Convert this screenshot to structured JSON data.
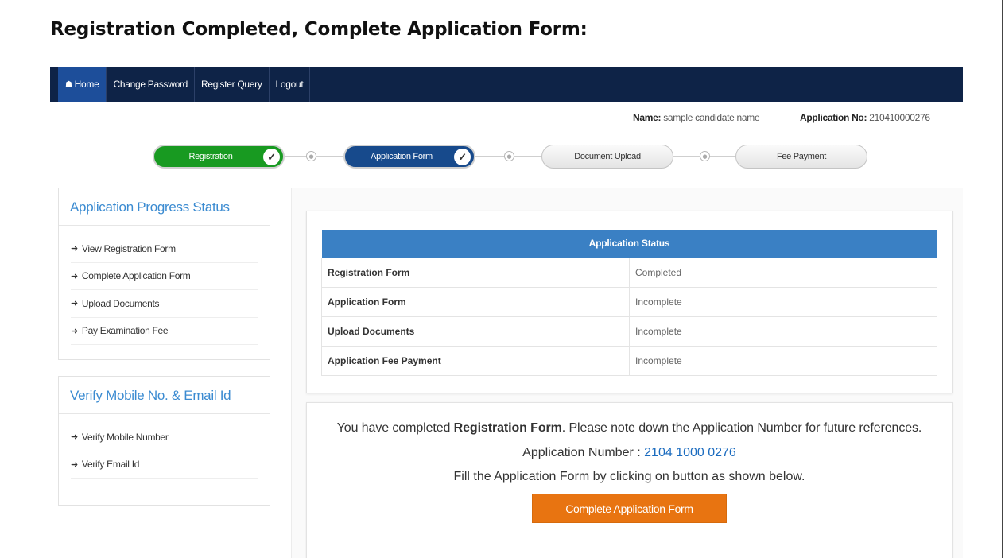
{
  "page": {
    "title": "Registration Completed, Complete Application Form:"
  },
  "nav": {
    "home": "Home",
    "change_password": "Change Password",
    "register_query": "Register Query",
    "logout": "Logout"
  },
  "candidate": {
    "name_label": "Name:",
    "name_value": "sample candidate name",
    "appno_label": "Application No:",
    "appno_value": "210410000276"
  },
  "steps": {
    "registration": "Registration",
    "application_form": "Application Form",
    "document_upload": "Document Upload",
    "fee_payment": "Fee Payment"
  },
  "progress_panel": {
    "heading": "Application Progress Status",
    "links": [
      "View Registration Form",
      "Complete Application Form",
      "Upload Documents",
      "Pay Examination Fee"
    ]
  },
  "verify_panel": {
    "heading": "Verify Mobile No. & Email Id",
    "links": [
      "Verify Mobile Number",
      "Verify Email Id"
    ]
  },
  "status_table": {
    "header": "Application Status",
    "rows": [
      {
        "label": "Registration Form",
        "status": "Completed"
      },
      {
        "label": "Application Form",
        "status": "Incomplete"
      },
      {
        "label": "Upload Documents",
        "status": "Incomplete"
      },
      {
        "label": "Application Fee Payment",
        "status": "Incomplete"
      }
    ]
  },
  "message": {
    "pre": "You have completed ",
    "bold": "Registration Form",
    "post": ". Please note down the Application Number for future references.",
    "appno_label": "Application Number : ",
    "appno_value": "2104 1000 0276",
    "fill_instruction": "Fill the Application Form by clicking on button as shown below.",
    "cta": "Complete Application Form"
  },
  "colors": {
    "navbar": "#0e2347",
    "active_tab": "#1d4e9a",
    "done": "#189a21",
    "current": "#174a8c",
    "table_header": "#3a80c4",
    "cta": "#e87411",
    "panel_heading": "#3b8bd1"
  }
}
